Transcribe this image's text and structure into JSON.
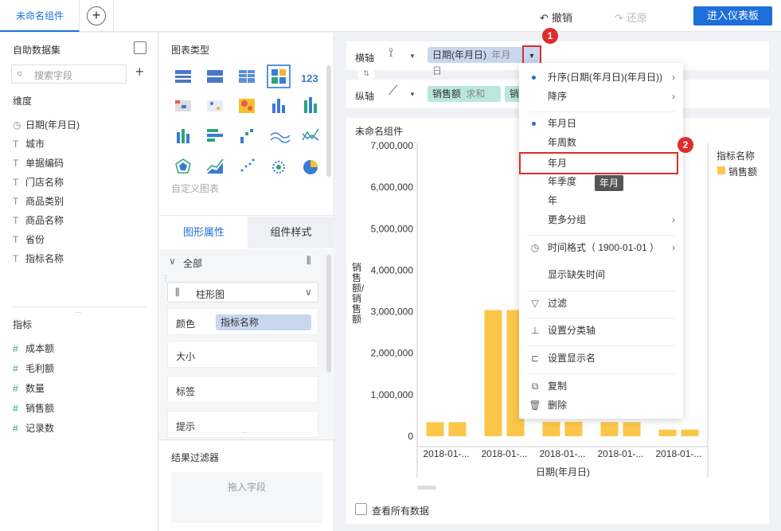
{
  "topbar": {
    "tab": "未命名组件",
    "undo": "撤销",
    "redo": "还原",
    "enter": "进入仪表板"
  },
  "left": {
    "title": "自助数据集",
    "search_placeholder": "搜索字段",
    "dimension_title": "维度",
    "dimensions": [
      {
        "icon": "clock-icon",
        "label": "日期(年月日)"
      },
      {
        "icon": "text-icon",
        "label": "城市"
      },
      {
        "icon": "text-icon",
        "label": "单据编码"
      },
      {
        "icon": "text-icon",
        "label": "门店名称"
      },
      {
        "icon": "text-icon",
        "label": "商品类别"
      },
      {
        "icon": "text-icon",
        "label": "商品名称"
      },
      {
        "icon": "text-icon",
        "label": "省份"
      },
      {
        "icon": "text-icon",
        "label": "指标名称"
      }
    ],
    "metric_title": "指标",
    "metrics": [
      {
        "icon": "hash-icon",
        "label": "成本额"
      },
      {
        "icon": "hash-icon",
        "label": "毛利额"
      },
      {
        "icon": "hash-icon",
        "label": "数量"
      },
      {
        "icon": "hash-icon",
        "label": "销售额"
      },
      {
        "icon": "hash-icon",
        "label": "记录数"
      }
    ]
  },
  "middle": {
    "chart_type_title": "图表类型",
    "custom_chart": "自定义图表",
    "tab_graph": "图形属性",
    "tab_style": "组件样式",
    "all": "全部",
    "chart_select": "柱形图",
    "color_label": "颜色",
    "color_chip": "指标名称",
    "size_label": "大小",
    "label_label": "标签",
    "tip_label": "提示",
    "filter_title": "结果过滤器",
    "drop_field": "拖入字段"
  },
  "axis": {
    "x_label": "横轴",
    "x_chip": "日期(年月日)",
    "x_chip_sub": "年月日",
    "y_label": "纵轴",
    "y_chip": "销售额",
    "y_chip_sub": "求和",
    "y_chip2": "销"
  },
  "chart": {
    "title": "未命名组件",
    "show_all": "查看所有数据",
    "legend_title": "指标名称",
    "legend_item": "销售额",
    "bar_color": "#fcc64a"
  },
  "chart_data": {
    "type": "bar",
    "xlabel": "日期(年月日)",
    "ylabel": "销售额/销售额",
    "categories": [
      "2018-01-...",
      "2018-01-...",
      "2018-01-...",
      "2018-01-...",
      "2018-01-..."
    ],
    "yticks": [
      "7,000,000",
      "6,000,000",
      "5,000,000",
      "4,000,000",
      "3,000,000",
      "2,000,000",
      "1,000,000",
      "0"
    ],
    "ylim": [
      0,
      7000000
    ],
    "values": [
      340000,
      340000,
      3040000,
      3040000,
      350000,
      350000,
      340000,
      340000,
      160000,
      160000
    ],
    "series": [
      {
        "name": "销售额"
      }
    ]
  },
  "menu": {
    "asc": "升序(日期(年月日)(年月日))",
    "desc": "降序",
    "ymd": "年月日",
    "ywn": "年周数",
    "ym": "年月",
    "yq": "年季度",
    "y": "年",
    "more": "更多分组",
    "time_format": "时间格式（ 1900-01-01 ）",
    "show_missing": "显示缺失时间",
    "filter": "过滤",
    "set_axis": "设置分类轴",
    "set_name": "设置显示名",
    "copy": "复制",
    "delete": "删除",
    "tooltip": "年月"
  },
  "badges": {
    "one": "1",
    "two": "2"
  }
}
